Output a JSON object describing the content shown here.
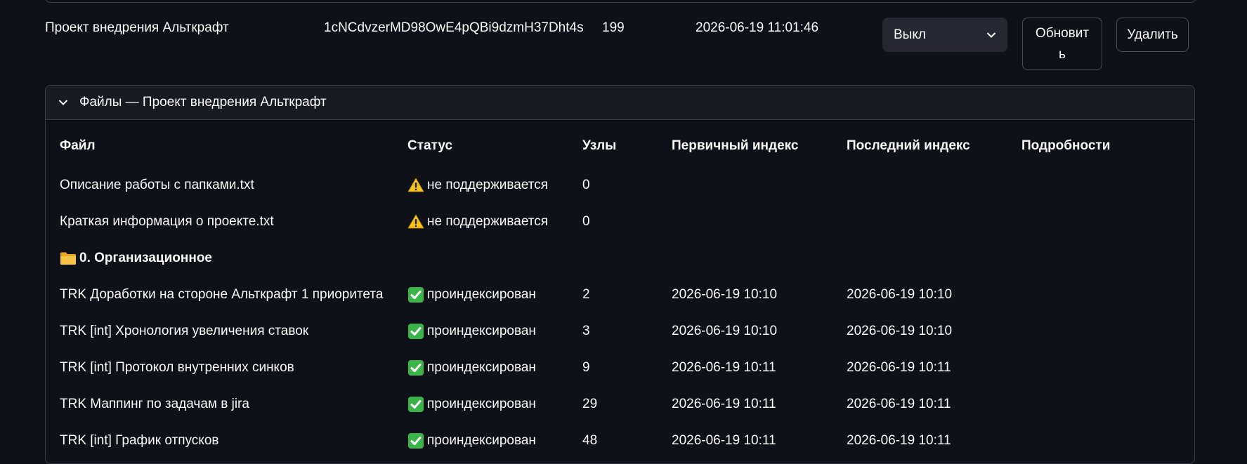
{
  "project": {
    "name": "Проект внедрения Альткрафт",
    "key": "1cNCdvzerMD98OwE4pQBi9dzmH37Dht4s",
    "count": "199",
    "date": "2026-06-19 11:01:46",
    "mode_selected": "Выкл",
    "refresh_label_line1": "Обновит",
    "refresh_label_line2": "ь",
    "delete_label": "Удалить"
  },
  "files_panel": {
    "title": "Файлы — Проект внедрения Альткрафт",
    "columns": {
      "file": "Файл",
      "status": "Статус",
      "nodes": "Узлы",
      "first_index": "Первичный индекс",
      "last_index": "Последний индекс",
      "details": "Подробности"
    },
    "rows": [
      {
        "file": "Описание работы с папками.txt",
        "status": "не поддерживается",
        "status_icon": "warning-icon",
        "nodes": "0",
        "first": "",
        "last": ""
      },
      {
        "file": "Краткая информация о проекте.txt",
        "status": "не поддерживается",
        "status_icon": "warning-icon",
        "nodes": "0",
        "first": "",
        "last": ""
      }
    ],
    "folder": "0. Организационное",
    "folder_icon": "folder-icon",
    "folder_rows": [
      {
        "file": "TRK Доработки на стороне Альткрафт 1 приоритета",
        "status": "проиндексирован",
        "status_icon": "check-icon",
        "nodes": "2",
        "first": "2026-06-19 10:10",
        "last": "2026-06-19 10:10"
      },
      {
        "file": "TRK [int] Хронология увеличения ставок",
        "status": "проиндексирован",
        "status_icon": "check-icon",
        "nodes": "3",
        "first": "2026-06-19 10:10",
        "last": "2026-06-19 10:10"
      },
      {
        "file": "TRK [int] Протокол внутренних синков",
        "status": "проиндексирован",
        "status_icon": "check-icon",
        "nodes": "9",
        "first": "2026-06-19 10:11",
        "last": "2026-06-19 10:11"
      },
      {
        "file": "TRK Маппинг по задачам в jira",
        "status": "проиндексирован",
        "status_icon": "check-icon",
        "nodes": "29",
        "first": "2026-06-19 10:11",
        "last": "2026-06-19 10:11"
      },
      {
        "file": "TRK [int] График отпусков",
        "status": "проиндексирован",
        "status_icon": "check-icon",
        "nodes": "48",
        "first": "2026-06-19 10:11",
        "last": "2026-06-19 10:11"
      }
    ],
    "colors": {
      "background": "#0e1117",
      "panel_header": "#191b23",
      "border": "#3a3d48",
      "select_bg": "#262730",
      "check_green": "#3bb54a",
      "warning_yellow": "#f5c518"
    }
  }
}
